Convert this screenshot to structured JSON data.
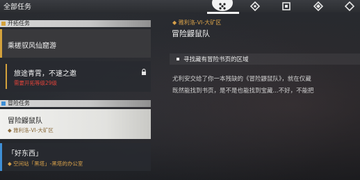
{
  "header": {
    "title": "全部任务",
    "tabs": [
      {
        "name": "all-quests",
        "active": true
      },
      {
        "name": "story",
        "active": false
      },
      {
        "name": "trailblaze",
        "active": false
      },
      {
        "name": "adventure",
        "active": false
      },
      {
        "name": "daily",
        "active": false
      }
    ]
  },
  "sidebar": {
    "section_trailblaze": {
      "label": "开拓任务"
    },
    "trailblaze_items": [
      {
        "title": "乘槎驭风仙窟游"
      },
      {
        "title": "旅途青霄，不速之邀",
        "requirement": "需要开拓等级29级"
      }
    ],
    "section_adventure": {
      "label": "冒险任务"
    },
    "adventure_items": [
      {
        "title": "冒险鼹鼠队",
        "location": "雅利洛-VI-大矿区"
      },
      {
        "title": "「好东西」",
        "location": "空间站「黑塔」-黑塔的办公室"
      }
    ]
  },
  "detail": {
    "location": "雅利洛-VI-大矿区",
    "title": "冒险鼹鼠队",
    "objective": "寻找藏有冒险书页的区域",
    "desc_line1": "尤利安交给了你一本残缺的《冒险鼹鼠队》，就在仅藏",
    "desc_line2": "既然能找到书页，是不是也能找到宝藏...不好，不能把"
  },
  "colors": {
    "accent_gold": "#d8a14a",
    "trailblaze_stripe": "#d4a23c",
    "adventure_stripe": "#3f8fd6",
    "requirement_red": "#e0433a"
  }
}
